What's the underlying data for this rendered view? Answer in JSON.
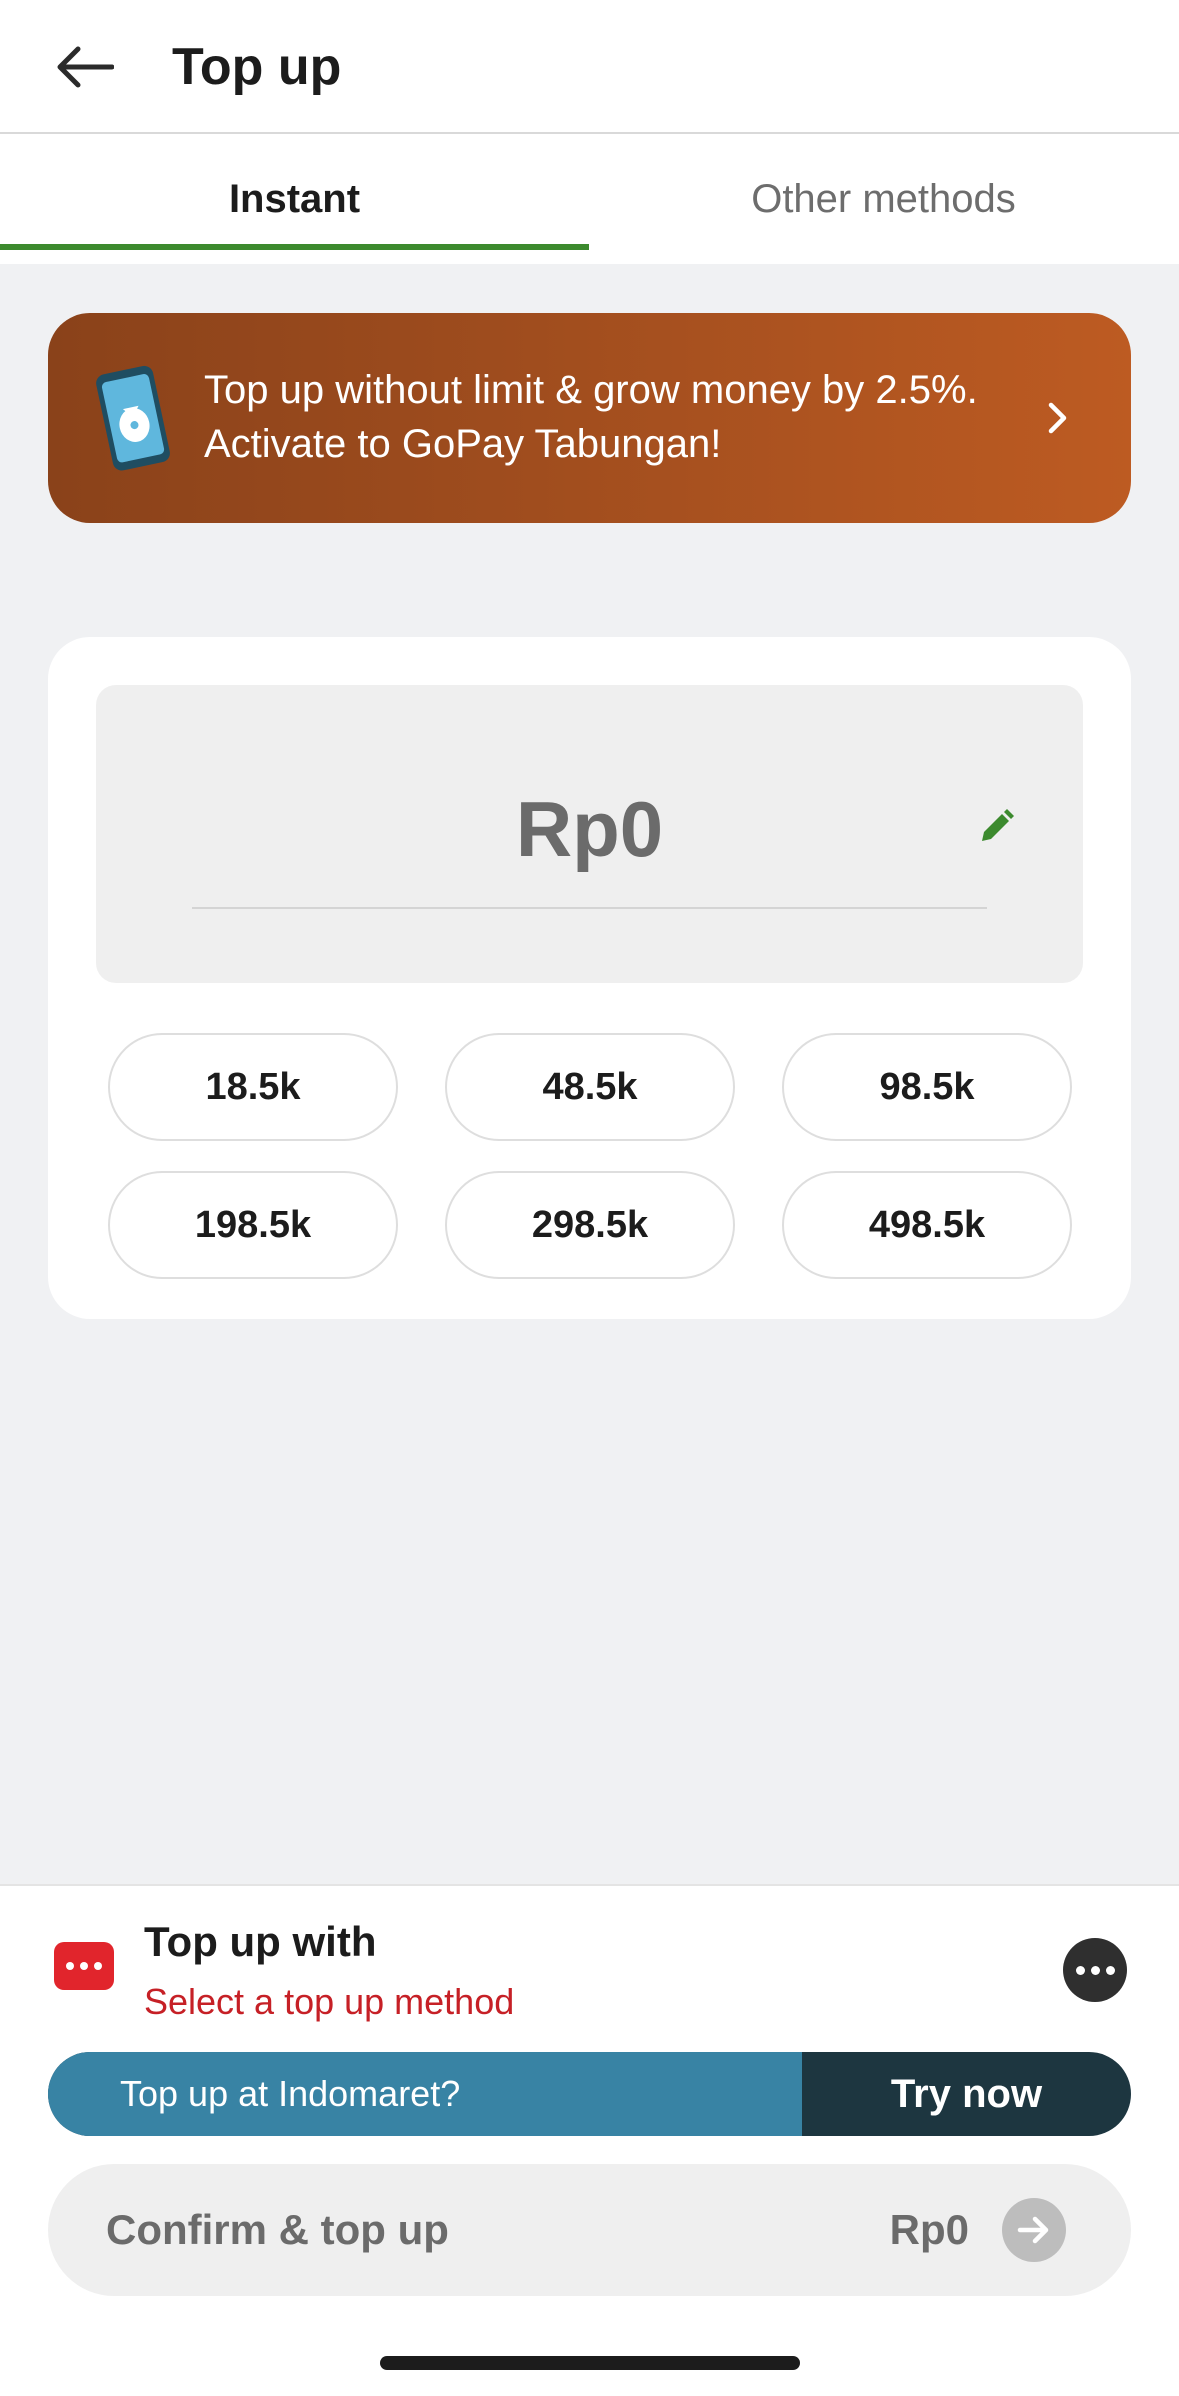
{
  "header": {
    "title": "Top up",
    "back_icon": "arrow-left-icon"
  },
  "tabs": [
    {
      "label": "Instant",
      "active": true
    },
    {
      "label": "Other methods",
      "active": false
    }
  ],
  "promo": {
    "text": "Top up without limit & grow money by 2.5%. Activate to GoPay Tabungan!",
    "icon": "phone-moneybag-icon",
    "chevron_icon": "chevron-right-icon",
    "gradient_colors": [
      "#8a421a",
      "#bd5b22"
    ]
  },
  "amount": {
    "value": "Rp0",
    "edit_icon": "pencil-icon"
  },
  "presets": [
    {
      "label": "18.5k"
    },
    {
      "label": "48.5k"
    },
    {
      "label": "98.5k"
    },
    {
      "label": "198.5k"
    },
    {
      "label": "298.5k"
    },
    {
      "label": "498.5k"
    }
  ],
  "method": {
    "title": "Top up with",
    "subtitle": "Select a top up method",
    "icon": "payment-method-icon",
    "more_icon": "more-options-icon"
  },
  "indomaret": {
    "text": "Top up at Indomaret?",
    "cta": "Try now"
  },
  "confirm": {
    "label": "Confirm & top up",
    "amount": "Rp0",
    "arrow_icon": "arrow-right-icon"
  },
  "colors": {
    "accent_green": "#3c8a2e",
    "error_red": "#c62026",
    "banner_blue": "#3883a4",
    "banner_dark": "#1d3640"
  }
}
